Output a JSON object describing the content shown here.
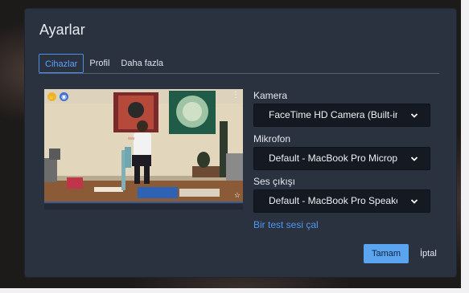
{
  "dialog": {
    "title": "Ayarlar",
    "tabs": [
      {
        "label": "Cihazlar",
        "active": true
      },
      {
        "label": "Profil",
        "active": false
      },
      {
        "label": "Daha fazla",
        "active": false
      }
    ]
  },
  "camera": {
    "label": "Kamera",
    "selected": "FaceTime HD Camera (Built-in)"
  },
  "microphone": {
    "label": "Mikrofon",
    "selected": "Default - MacBook Pro Microphone"
  },
  "speaker": {
    "label": "Ses çıkışı",
    "selected": "Default - MacBook Pro Speakers"
  },
  "test_sound_link": "Bir test sesi çal",
  "buttons": {
    "ok": "Tamam",
    "cancel": "İptal"
  },
  "preview": {
    "badge_1_icon": "hand-raise-icon",
    "badge_2_icon": "megaphone-icon",
    "menu_icon": "more-vertical-icon",
    "pin_icon": "star-icon"
  },
  "colors": {
    "dialog_bg": "#2a3240",
    "accent": "#5ba4f0",
    "link": "#4f96f0",
    "select_bg": "#141922"
  }
}
